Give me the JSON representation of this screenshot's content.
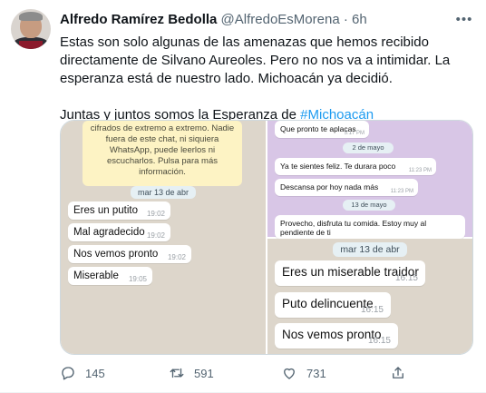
{
  "tweet": {
    "author_name": "Alfredo Ramírez Bedolla",
    "handle": "@AlfredoEsMorena",
    "separator": "·",
    "time": "6h",
    "text_line1": "Estas son solo algunas de las amenazas que hemos recibido directamente de Silvano Aureoles. Pero no nos va a intimidar. La esperanza está de nuestro lado. Michoacán ya decidió.",
    "text_line2_prefix": "Juntas y juntos somos la Esperanza de ",
    "hashtag": "#Michoacán"
  },
  "media": {
    "left": {
      "encryption_notice": "cifrados de extremo a extremo. Nadie fuera de este chat, ni siquiera WhatsApp, puede leerlos ni escucharlos. Pulsa para más información.",
      "date": "mar 13 de abr",
      "messages": [
        {
          "text": "Eres un putito",
          "time": "19:02"
        },
        {
          "text": "Mal agradecido",
          "time": "19:02"
        },
        {
          "text": "Nos vemos pronto",
          "time": "19:02"
        },
        {
          "text": "Miserable",
          "time": "19:05"
        }
      ]
    },
    "top_right": {
      "msg1": {
        "text": "Que pronto te aplacas",
        "time": "5:17 PM"
      },
      "date1": "2 de mayo",
      "msg2": {
        "text": "Ya te sientes feliz. Te durara poco",
        "time": "11:23 PM"
      },
      "msg3": {
        "text": "Descansa por hoy nada más",
        "time": "11:23 PM"
      },
      "date2": "13 de mayo",
      "msg4": {
        "text": "Provecho, disfruta tu comida. Estoy muy al pendiente de ti"
      }
    },
    "bottom_right": {
      "date": "mar 13 de abr",
      "messages": [
        {
          "text": "Eres un miserable traidor",
          "time": "16:15"
        },
        {
          "text": "Puto delincuente",
          "time": "16:15"
        },
        {
          "text": "Nos vemos pronto",
          "time": "16:15"
        }
      ]
    }
  },
  "actions": {
    "reply_count": "145",
    "retweet_count": "591",
    "like_count": "731"
  },
  "icons": {
    "more": "more-icon",
    "reply": "reply-icon",
    "retweet": "retweet-icon",
    "like": "heart-icon",
    "share": "share-icon"
  },
  "colors": {
    "link": "#1d9bf0",
    "secondary_text": "#536471"
  }
}
